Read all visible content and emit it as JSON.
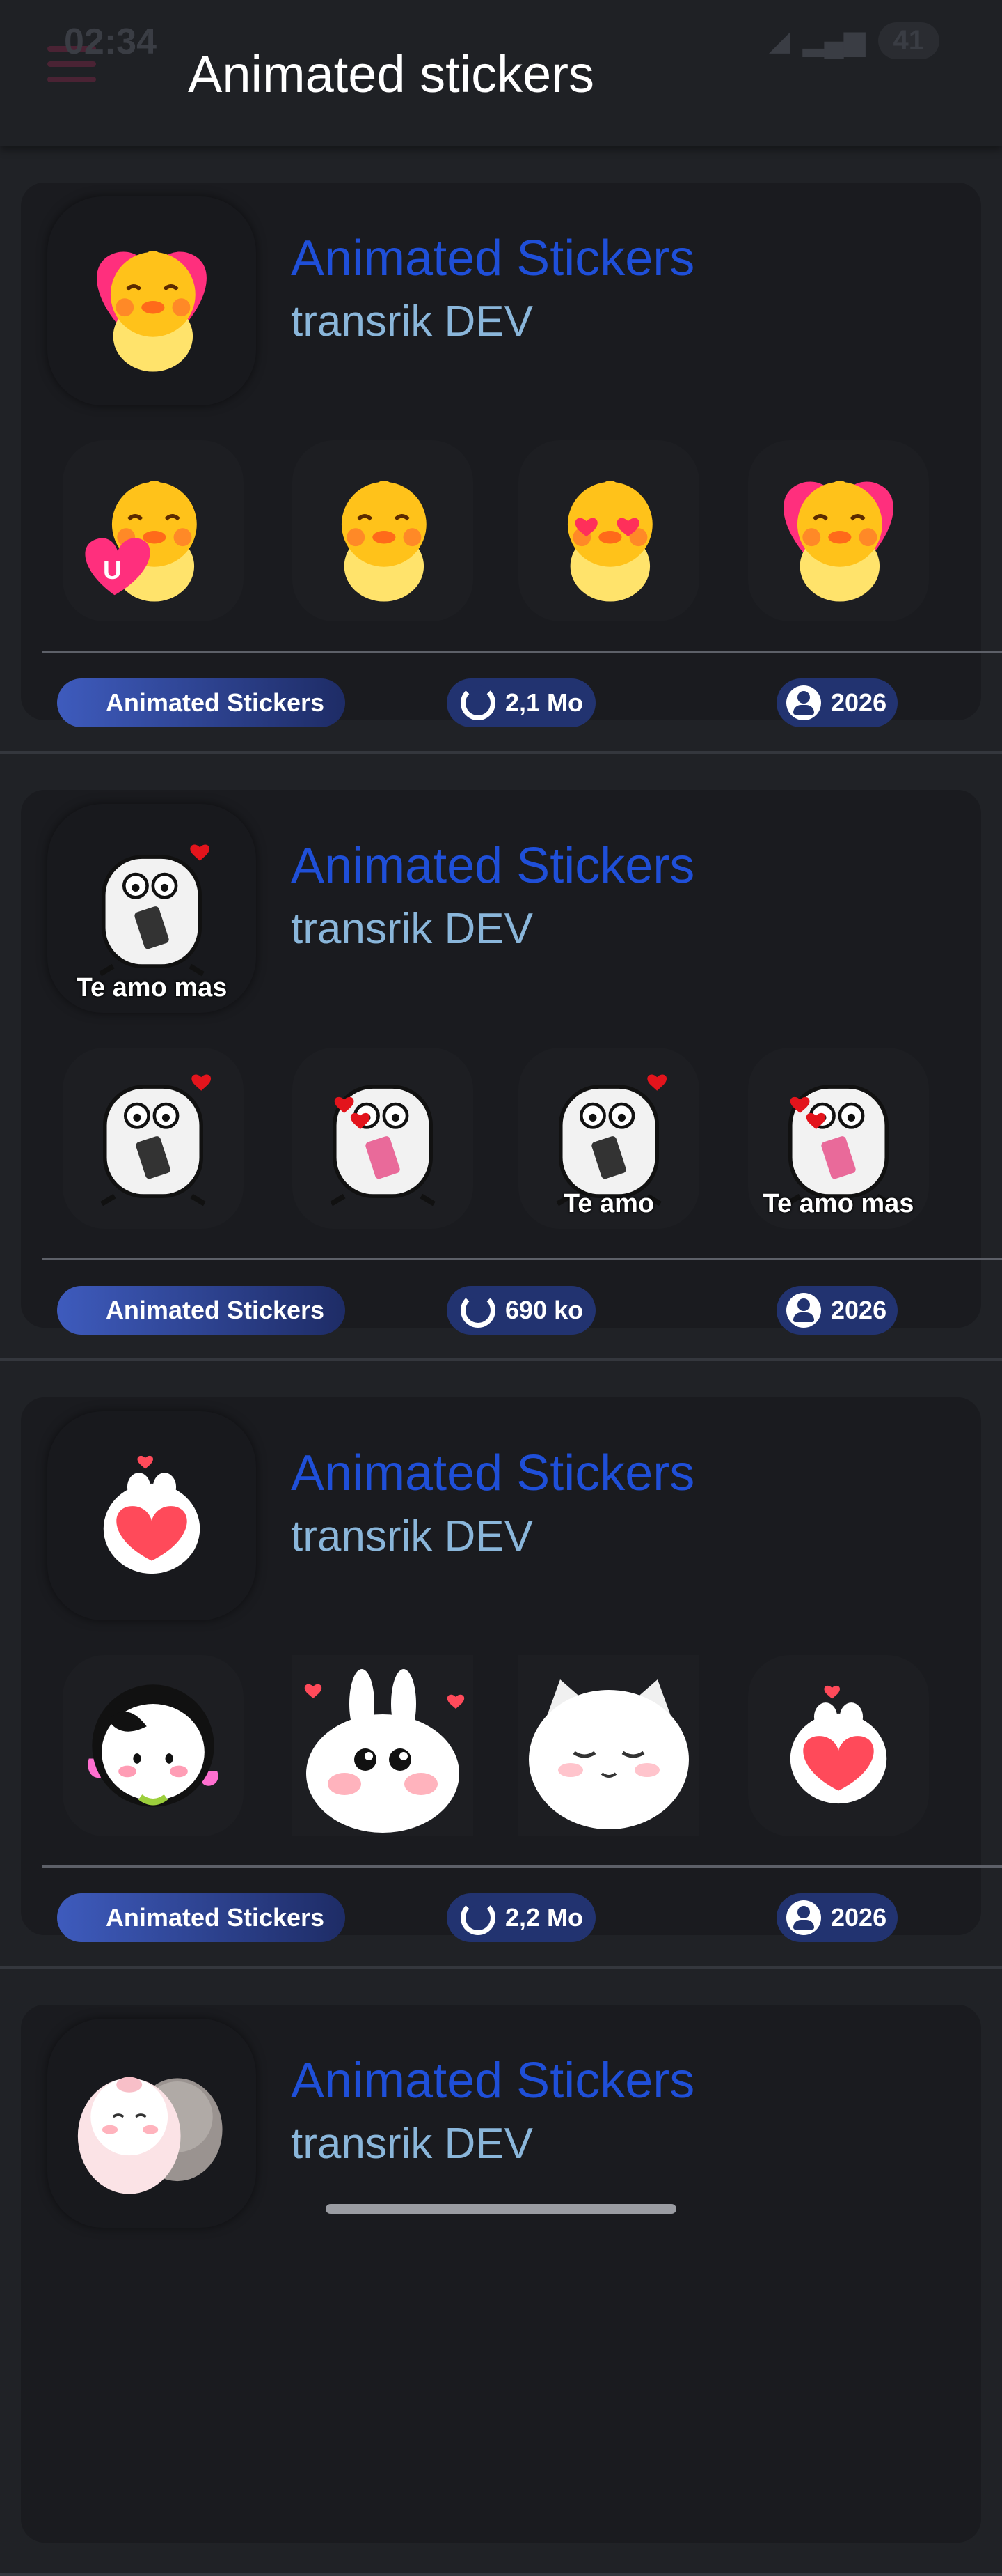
{
  "status": {
    "time": "02:34",
    "battery": "41"
  },
  "appbar": {
    "title": "Animated stickers"
  },
  "packs": [
    {
      "title": "Animated Stickers",
      "author": "transrik DEV",
      "chip_label": "Animated Stickers",
      "size": "2,1 Mo",
      "year": "2026",
      "style": "chick",
      "previews": [
        {
          "kind": "chick-heart-hold",
          "caption": ""
        },
        {
          "kind": "chick-smile",
          "caption": ""
        },
        {
          "kind": "chick-love",
          "caption": ""
        },
        {
          "kind": "chick-big-heart",
          "caption": ""
        }
      ]
    },
    {
      "title": "Animated Stickers",
      "author": "transrik DEV",
      "chip_label": "Animated Stickers",
      "size": "690 ko",
      "year": "2026",
      "style": "blob",
      "cover_caption": "Te amo mas",
      "previews": [
        {
          "kind": "blob-phone",
          "caption": ""
        },
        {
          "kind": "blob-hearts",
          "caption": ""
        },
        {
          "kind": "blob-phone",
          "caption": "Te amo"
        },
        {
          "kind": "blob-hearts",
          "caption": "Te amo mas"
        }
      ]
    },
    {
      "title": "Animated Stickers",
      "author": "transrik DEV",
      "chip_label": "Animated Stickers",
      "size": "2,2 Mo",
      "year": "2026",
      "style": "cute",
      "previews": [
        {
          "kind": "cow",
          "caption": ""
        },
        {
          "kind": "bunny",
          "caption": ""
        },
        {
          "kind": "cat",
          "caption": ""
        },
        {
          "kind": "bear-heart",
          "caption": ""
        }
      ]
    },
    {
      "title": "Animated Stickers",
      "author": "transrik DEV",
      "chip_label": "",
      "size": "",
      "year": "",
      "style": "pig",
      "previews": []
    }
  ]
}
